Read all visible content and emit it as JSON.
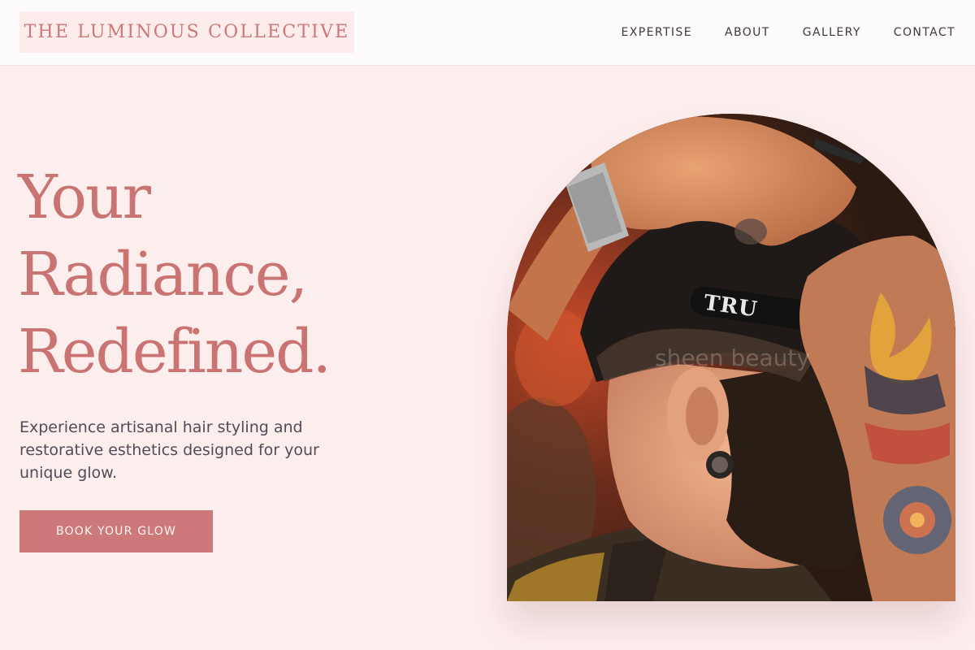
{
  "header": {
    "logo_text": "THE LUMINOUS COLLECTIVE",
    "nav": [
      {
        "label": "EXPERTISE"
      },
      {
        "label": "ABOUT"
      },
      {
        "label": "GALLERY"
      },
      {
        "label": "CONTACT"
      }
    ]
  },
  "hero": {
    "title_lines": [
      "Your",
      "Radiance,",
      "Redefined."
    ],
    "description": "Experience artisanal hair styling and restorative esthetics designed for your unique glow.",
    "cta_label": "BOOK YOUR GLOW"
  },
  "image": {
    "razor_text": "TRU",
    "watermark": "sheen beauty"
  },
  "colors": {
    "accent": "#cd7777",
    "page_background": "#fdeeee",
    "header_background": "#fefbfc",
    "body_text": "#4f4d57"
  }
}
